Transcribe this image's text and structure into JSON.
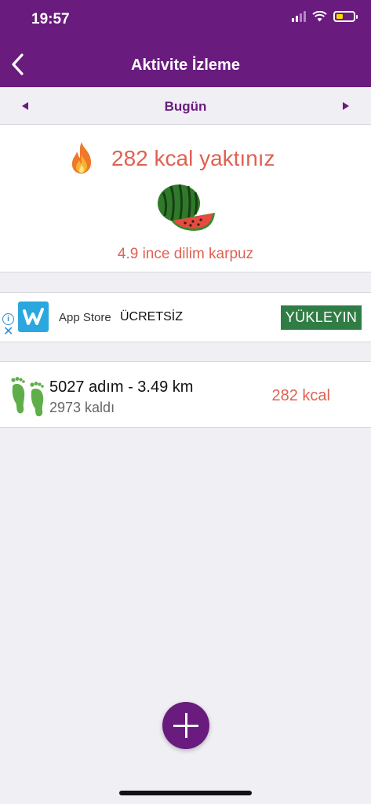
{
  "status_bar": {
    "time": "19:57"
  },
  "nav": {
    "title": "Aktivite İzleme"
  },
  "date_selector": {
    "label": "Bugün",
    "prev_icon": "triangle-left-icon",
    "next_icon": "triangle-right-icon"
  },
  "summary": {
    "burned_text": "282 kcal yaktınız",
    "equivalent_text": "4.9 ince dilim karpuz",
    "icon": "flame-icon",
    "food_icon": "watermelon-icon"
  },
  "ad": {
    "store": "App Store",
    "price": "ÜCRETSİZ",
    "install_label": "YÜKLEYIN",
    "install_color": "#2f7d45"
  },
  "activity": {
    "steps_text": "5027 adım - 3.49 km",
    "remaining_text": "2973 kaldı",
    "kcal_text": "282 kcal",
    "icon": "footprints-icon"
  },
  "colors": {
    "brand": "#6a1b7e",
    "accent": "#e06152"
  }
}
